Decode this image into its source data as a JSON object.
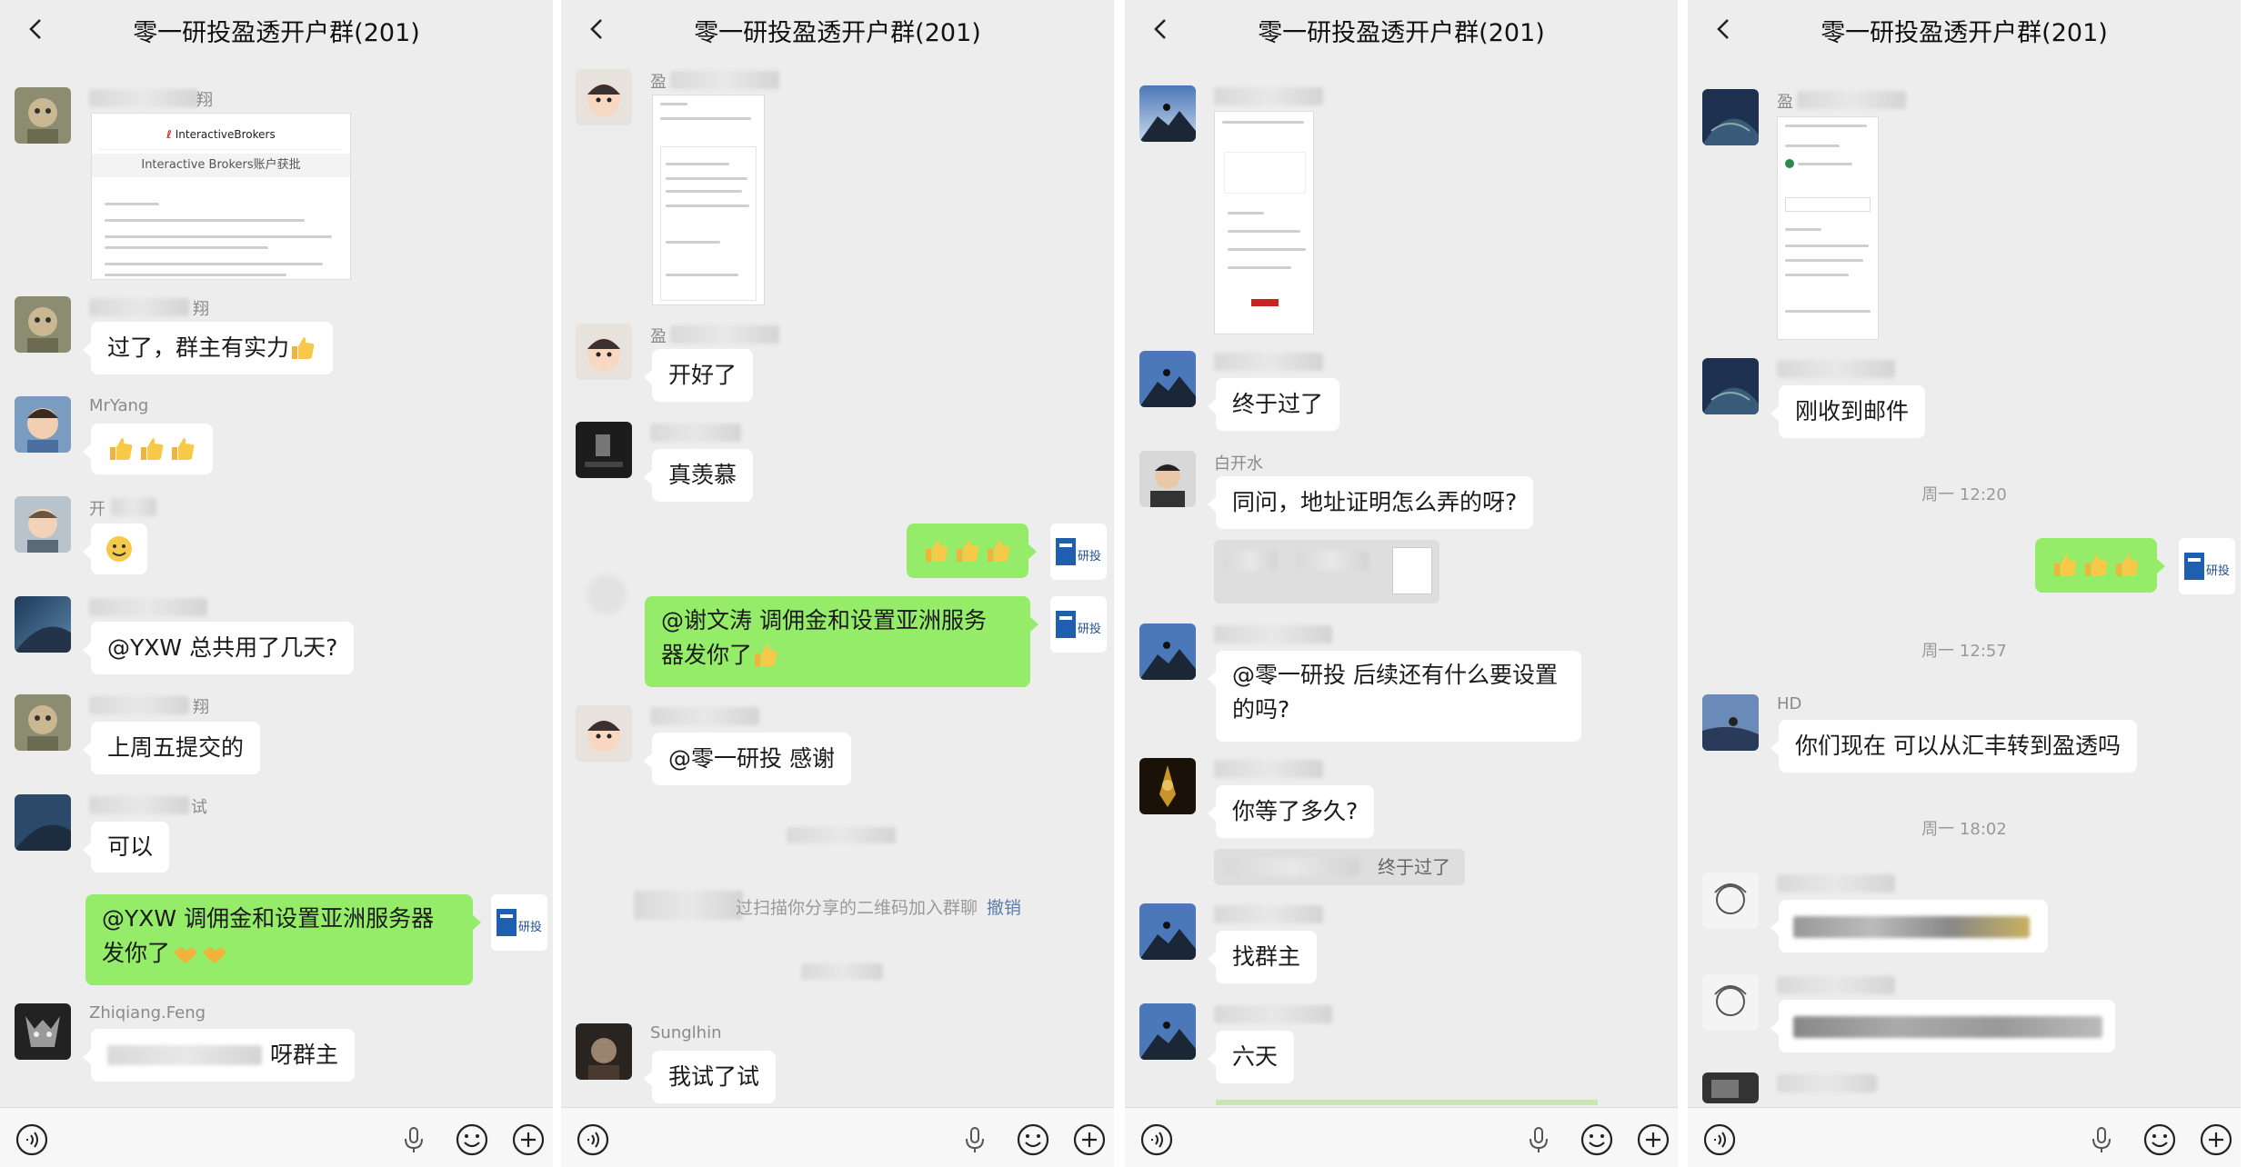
{
  "chat_title": "零一研投盈透开户群(201)",
  "panel1": {
    "ib_brand": "InteractiveBrokers",
    "ib_card_title": "Interactive Brokers账户获批",
    "name_suffix_1": "翔",
    "msg_1": "过了，群主有实力",
    "name_mryang": "MrYang",
    "name_kai": "开",
    "msg_yxw": "@YXW  总共用了几天?",
    "msg_last_friday": "上周五提交的",
    "name_suffix_shi": "试",
    "msg_ok": "可以",
    "msg_mine_line1": "@YXW  调佣金和设置亚洲服务器",
    "msg_mine_line2": "发你了",
    "name_feng": "Zhiqiang.Feng",
    "msg_feng": "呀群主"
  },
  "panel2": {
    "name_ying": "盈",
    "msg_opened": "开好了",
    "msg_envy": "真羡慕",
    "msg_mine_line1": "@谢文涛  调佣金和设置亚洲服务",
    "msg_mine_line2": "器发你了",
    "msg_thanks": "@零一研投  感谢",
    "sys_text": "过扫描你分享的二维码加入群聊",
    "sys_link": "撤销",
    "name_sunglhin": "Sunglhin",
    "msg_tried": "我试了试"
  },
  "panel3": {
    "msg_finally": "终于过了",
    "name_baikaishui": "白开水",
    "msg_address": "同问，地址证明怎么弄的呀?",
    "msg_followup_line1": "@零一研投  后续还有什么要设置",
    "msg_followup_line2": "的吗?",
    "msg_how_long": "你等了多久?",
    "quote_text": "终于过了",
    "msg_find_owner": "找群主",
    "msg_six_days": "六天"
  },
  "panel4": {
    "name_ying": "盈",
    "msg_email": "刚收到邮件",
    "time_1": "周一 12:20",
    "time_2": "周一 12:57",
    "name_hd": "HD",
    "msg_hsbc": "你们现在  可以从汇丰转到盈透吗",
    "time_3": "周一 18:02"
  },
  "icons": [
    "back-icon",
    "voice-icon",
    "microphone-icon",
    "emoji-icon",
    "plus-icon",
    "thumbs-up-icon",
    "handshake-icon"
  ],
  "colors": {
    "bg": "#ededed",
    "my_bubble": "#95ec69",
    "other_bubble": "#ffffff",
    "link": "#5f7ab0"
  }
}
